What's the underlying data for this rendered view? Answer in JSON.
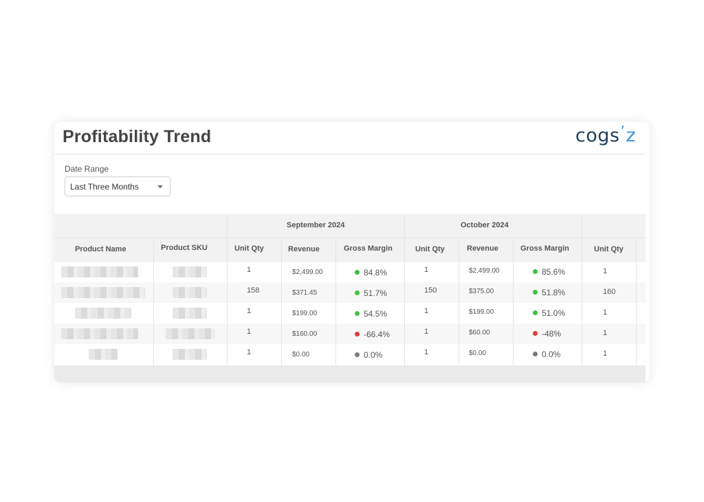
{
  "title": "Profitability Trend",
  "logo": {
    "part1": "cogs",
    "tick": "’",
    "part2": "z"
  },
  "filter": {
    "label": "Date Range",
    "value": "Last Three Months"
  },
  "months": [
    "September 2024",
    "October 2024"
  ],
  "columns": {
    "product_name": "Product Name",
    "product_sku": "Product SKU",
    "unit_qty": "Unit Qty",
    "revenue": "Revenue",
    "gross_margin": "Gross Margin"
  },
  "rows": [
    {
      "sep": {
        "qty": "1",
        "rev": "$2,499.00",
        "gm": "84.8%",
        "status": "g"
      },
      "oct": {
        "qty": "1",
        "rev": "$2,499.00",
        "gm": "85.6%",
        "status": "g"
      },
      "nov_qty": "1"
    },
    {
      "sep": {
        "qty": "158",
        "rev": "$371.45",
        "gm": "51.7%",
        "status": "g"
      },
      "oct": {
        "qty": "150",
        "rev": "$375.00",
        "gm": "51.8%",
        "status": "g"
      },
      "nov_qty": "160"
    },
    {
      "sep": {
        "qty": "1",
        "rev": "$199.00",
        "gm": "54.5%",
        "status": "g"
      },
      "oct": {
        "qty": "1",
        "rev": "$199.00",
        "gm": "51.0%",
        "status": "g"
      },
      "nov_qty": "1"
    },
    {
      "sep": {
        "qty": "1",
        "rev": "$160.00",
        "gm": "-66.4%",
        "status": "r"
      },
      "oct": {
        "qty": "1",
        "rev": "$60.00",
        "gm": "-48%",
        "status": "r"
      },
      "nov_qty": "1"
    },
    {
      "sep": {
        "qty": "1",
        "rev": "$0.00",
        "gm": "0.0%",
        "status": "n"
      },
      "oct": {
        "qty": "1",
        "rev": "$0.00",
        "gm": "0.0%",
        "status": "n"
      },
      "nov_qty": "1"
    }
  ],
  "colors": {
    "positive": "#3fc23f",
    "negative": "#e23a3a",
    "neutral": "#7a7a7a",
    "brand": "#3c94dc"
  }
}
